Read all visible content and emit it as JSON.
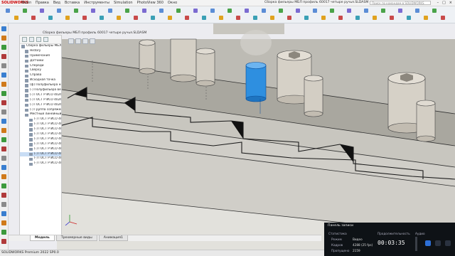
{
  "menubar": {
    "logo": "SOLIDWORKS",
    "items": [
      "Файл",
      "Правка",
      "Вид",
      "Вставка",
      "Инструменты",
      "Simulation",
      "PhotoView 360",
      "Окно"
    ],
    "title": "Сборка фильеры МБЛ профиль 60017 четыре ручья.SLDASM",
    "search_placeholder": "Поиск по командам в SOLIDWORKS"
  },
  "doc_title": "Сборка фильеры МБЛ профиль 60017 четыре ручья.SLDASM",
  "feature_tree": {
    "items": [
      "Сборка фильеры МБЛ профиль 60017 четыре ручья (По",
      "History",
      "Примечания",
      "Датчики",
      "Спереди",
      "Сверху",
      "Справа",
      "Исходная точка",
      "(ф) Полуфильера нижняя",
      "(-) Полуфильера верхняя мс",
      "(-) ГОСТ Р ИСО 4026-2013",
      "(-) ГОСТ Р ИСО 4026-2013",
      "(-) ГОСТ Р ИСО 4026-2013",
      "(-) Группа сопряжений 1",
      "Местный линейный масс",
      "(-) ГОСТ Р ИСО 4026-2",
      "(-) ГОСТ Р ИСО 4026-2",
      "(-) ГОСТ Р ИСО 4026-2",
      "(-) ГОСТ Р ИСО 4026-2",
      "(-) ГОСТ Р ИСО 4026-2",
      "(-) ГОСТ Р ИСО 4026-2",
      "(-) ГОСТ Р ИСО 4026-2",
      "(-) ГОСТ Р ИСО 4026-2",
      "(-) ГОСТ Р ИСО 4026-2",
      "(-) ГОСТ Р ИСО 4026-2"
    ],
    "selected_index": 22
  },
  "bottom_tabs": [
    "Модель",
    "Трехмерные виды",
    "Анимация1"
  ],
  "statusbar": "SOLIDWORKS Premium 2022 SP0.0",
  "recorder": {
    "title": "Панель записи",
    "stats_label": "Статистика",
    "mode_label": "Режим",
    "mode_value": "Видео",
    "frames_label": "Кадров",
    "frames_value": "4288 (25 fps)",
    "dropped_label": "Пропущено",
    "dropped_value": "2159",
    "duration_label": "Продолжительность",
    "duration_value": "00:03:35",
    "audio_label": "Аудио"
  }
}
